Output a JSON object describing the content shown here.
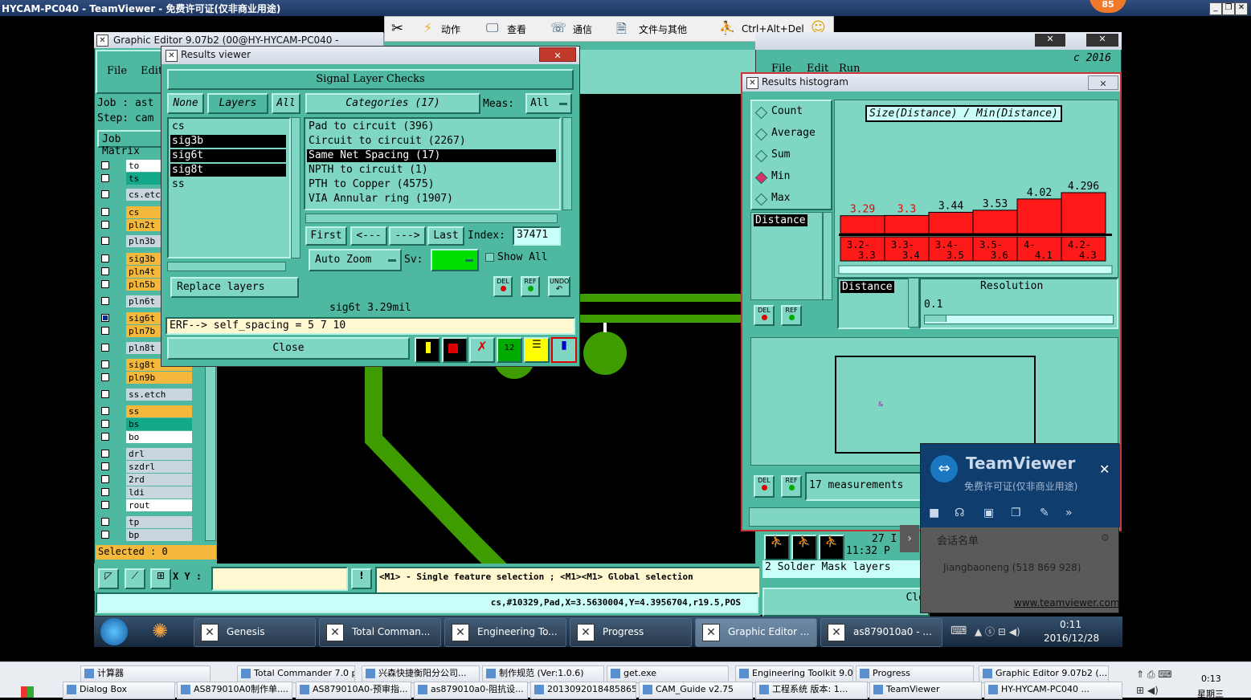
{
  "tv_window_title": "HYCAM-PC040 - TeamViewer - 免费许可证(仅非商业用途)",
  "tv_badge": "85",
  "tv_toolbar": {
    "actions": "动作",
    "view": "查看",
    "comm": "通信",
    "files": "文件与其他",
    "cad": "Ctrl+Alt+Del"
  },
  "graphic_editor": {
    "title": "Graphic Editor 9.07b2 (00@HY-HYCAM-PC040 - Windows, …",
    "menu_file": "File",
    "menu_edit": "Edit",
    "job": "Job : ast",
    "step": "Step: cam",
    "job_matrix": "Job Matrix",
    "layers": [
      {
        "name": "to",
        "color": "#ffffff"
      },
      {
        "name": "ts",
        "color": "#13a88a"
      },
      {
        "name": "cs.etch",
        "color": "#c9d6de"
      },
      {
        "name": "cs",
        "color": "#f3b83c"
      },
      {
        "name": "pln2t",
        "color": "#f3b83c"
      },
      {
        "name": "pln3b",
        "color": "#c9d6de"
      },
      {
        "name": "sig3b",
        "color": "#f3b83c"
      },
      {
        "name": "pln4t",
        "color": "#f3b83c"
      },
      {
        "name": "pln5b",
        "color": "#f3b83c"
      },
      {
        "name": "pln6t",
        "color": "#c9d6de"
      },
      {
        "name": "sig6t",
        "color": "#f3b83c"
      },
      {
        "name": "pln7b",
        "color": "#f3b83c"
      },
      {
        "name": "pln8t",
        "color": "#c9d6de"
      },
      {
        "name": "sig8t",
        "color": "#f3b83c"
      },
      {
        "name": "pln9b",
        "color": "#f3b83c"
      },
      {
        "name": "ss.etch",
        "color": "#c9d6de"
      },
      {
        "name": "ss",
        "color": "#f3b83c"
      },
      {
        "name": "bs",
        "color": "#13a88a"
      },
      {
        "name": "bo",
        "color": "#ffffff"
      },
      {
        "name": "drl",
        "color": "#c9d6de"
      },
      {
        "name": "szdrl",
        "color": "#c9d6de"
      },
      {
        "name": "2rd",
        "color": "#c9d6de"
      },
      {
        "name": "ldi",
        "color": "#c9d6de"
      },
      {
        "name": "rout",
        "color": "#ffffff"
      },
      {
        "name": "tp",
        "color": "#c9d6de"
      },
      {
        "name": "bp",
        "color": "#c9d6de"
      }
    ],
    "selected": "Selected : 0",
    "xy_label": "X Y :",
    "hint": "<M1> - Single feature selection ; <M1><M1> Global selection",
    "status": "cs,#10329,Pad,X=3.5630004,Y=4.3956704,r19.5,POS"
  },
  "results_viewer": {
    "title": "Results viewer",
    "header": "Signal Layer Checks",
    "none_btn": "None",
    "layers_btn": "Layers",
    "all_btn": "All",
    "categories_btn": "Categories (17)",
    "meas_label": "Meas:",
    "meas_value": "All",
    "layer_list": [
      "cs",
      "sig3b",
      "sig6t",
      "sig8t",
      "ss"
    ],
    "categories": [
      "Pad to circuit (396)",
      "Circuit to circuit (2267)",
      "Same Net Spacing (17)",
      "NPTH to circuit (1)",
      "PTH to Copper (4575)",
      "VIA Annular ring (1907)"
    ],
    "first": "First",
    "prev": "<---",
    "next": "--->",
    "last": "Last",
    "index_label": "Index:",
    "index_value": "37471",
    "replace_layers": "Replace layers",
    "auto_zoom": "Auto Zoom",
    "sv_label": "Sv:",
    "show_all": "Show All",
    "del": "DEL",
    "ref": "REF",
    "undo": "UNDO",
    "result_line": "sig6t 3.29mil",
    "erf_line": "ERF--> self_spacing = 5 7 10",
    "close": "Close"
  },
  "histogram": {
    "title": "Results histogram",
    "options": [
      "Count",
      "Average",
      "Sum",
      "Min",
      "Max"
    ],
    "selected_option": "Min",
    "chart_title": "Size(Distance) / Min(Distance)",
    "bar_values": [
      "3.29",
      "3.3",
      "3.44",
      "3.53",
      "4.02",
      "4.296"
    ],
    "bins": [
      "3.2-3.3",
      "3.3-3.4",
      "3.4-3.5",
      "3.5-3.6",
      "4-4.1",
      "4.2-4.3"
    ],
    "distance_label": "Distance",
    "resolution_label": "Resolution",
    "resolution_value": "0.1",
    "measurements": "17 measurements"
  },
  "bg_editor": {
    "menu": [
      "File",
      "Edit",
      "Run"
    ],
    "date": "c 2016",
    "time_bits": "27 I",
    "time": "11:32 P",
    "solder_mask": "2 Solder Mask layers",
    "close_frag": "Clo"
  },
  "teamviewer_panel": {
    "brand": "TeamViewer",
    "sub": "免费许可证(仅非商业用途)",
    "session_list": "会话名单",
    "user": "Jiangbaoneng (518 869 928)",
    "url": "www.teamviewer.com"
  },
  "remote_taskbar": {
    "items": [
      "Genesis",
      "Total Comman...",
      "Engineering To...",
      "Progress",
      "Graphic Editor ...",
      "as879010a0 - ..."
    ],
    "time": "0:11",
    "date": "2016/12/28"
  },
  "local_taskbar": {
    "row1": [
      "计算器",
      "Total Commander 7.0 p...",
      "兴森快捷衡阳分公司...",
      "制作规范 (Ver:1.0.6)",
      "get.exe",
      "Engineering Toolkit 9.0...",
      "Progress",
      "Graphic Editor 9.07b2 (..."
    ],
    "row2": [
      "Dialog Box",
      "AS879010A0制作单....",
      "AS879010A0-预审指...",
      "as879010a0-阻抗设...",
      "20130920184858655...",
      "CAM_Guide v2.75",
      "工程系统  版本: 1...",
      "TeamViewer",
      "HY-HYCAM-PC040 ..."
    ],
    "time": "0:13",
    "day": "星期三"
  }
}
